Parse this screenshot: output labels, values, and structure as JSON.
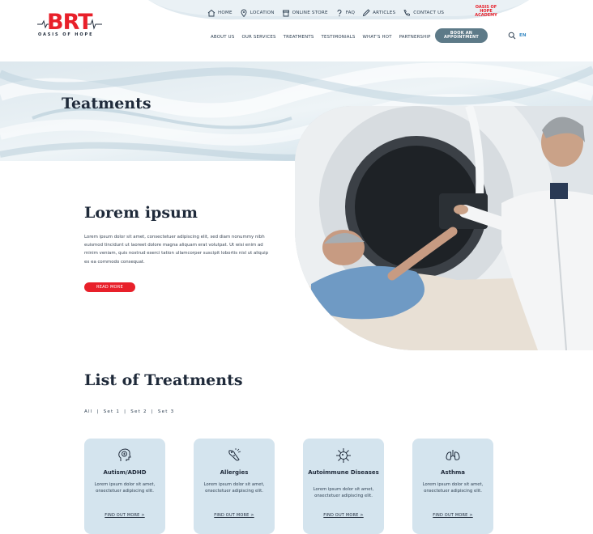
{
  "brand": {
    "logo_text": "BRT",
    "logo_sub": "OASIS OF HOPE",
    "academy": "OASIS OF HOPE ACADEMY",
    "red": "#e8202a",
    "dark": "#1f2a3a",
    "accent": "#5d7a88",
    "card_bg": "#d4e4ee"
  },
  "utility_nav": [
    {
      "label": "HOME",
      "icon": "home-icon"
    },
    {
      "label": "LOCATION",
      "icon": "location-pin-icon"
    },
    {
      "label": "ONLINE STORE",
      "icon": "store-icon"
    },
    {
      "label": "FAQ",
      "icon": "question-icon"
    },
    {
      "label": "ARTICLES",
      "icon": "pencil-icon"
    },
    {
      "label": "CONTACT US",
      "icon": "phone-icon"
    }
  ],
  "main_nav": [
    "ABOUT US",
    "OUR SERVICES",
    "TREATMENTS",
    "TESTIMONIALS",
    "WHAT'S HOT",
    "PARTNERSHIP"
  ],
  "book_button": "BOOK AN APPOINTMENT",
  "language": "EN",
  "hero": {
    "title": "Teatments"
  },
  "intro": {
    "title": "Lorem ipsum",
    "text": "Lorem ipsum dolor sit amet, consectetuer adipiscing elit, sed diam nonummy nibh euismod tincidunt ut laoreet dolore magna aliquam erat volutpat. Ut wisi enim ad minim veniam, quis nostrud exerci tation ullamcorper suscipit lobortis nisl ut aliquip ex ea commodo consequat.",
    "button": "READ MORE"
  },
  "list": {
    "title": "List of Treatments",
    "filters": [
      "All",
      "Set 1",
      "Set 2",
      "Set 3"
    ],
    "cards": [
      {
        "title": "Autism/ADHD",
        "text": "Lorem ipsum dolor sit amet, onsectetuer adipiscing elit.",
        "link": "FIND OUT MORE >",
        "icon": "brain-head-icon"
      },
      {
        "title": "Allergies",
        "text": "Lorem ipsum dolor sit amet, onsectetuer adipiscing elit.",
        "link": "FIND OUT MORE >",
        "icon": "allergy-icon"
      },
      {
        "title": "Autoimmune Diseases",
        "text": "Lorem ipsum dolor sit amet, onsectetuer adipiscing elit.",
        "link": "FIND OUT MORE >",
        "icon": "virus-icon"
      },
      {
        "title": "Asthma",
        "text": "Lorem ipsum dolor sit amet, onsectetuer adipiscing elit.",
        "link": "FIND OUT MORE >",
        "icon": "lungs-icon"
      }
    ]
  }
}
